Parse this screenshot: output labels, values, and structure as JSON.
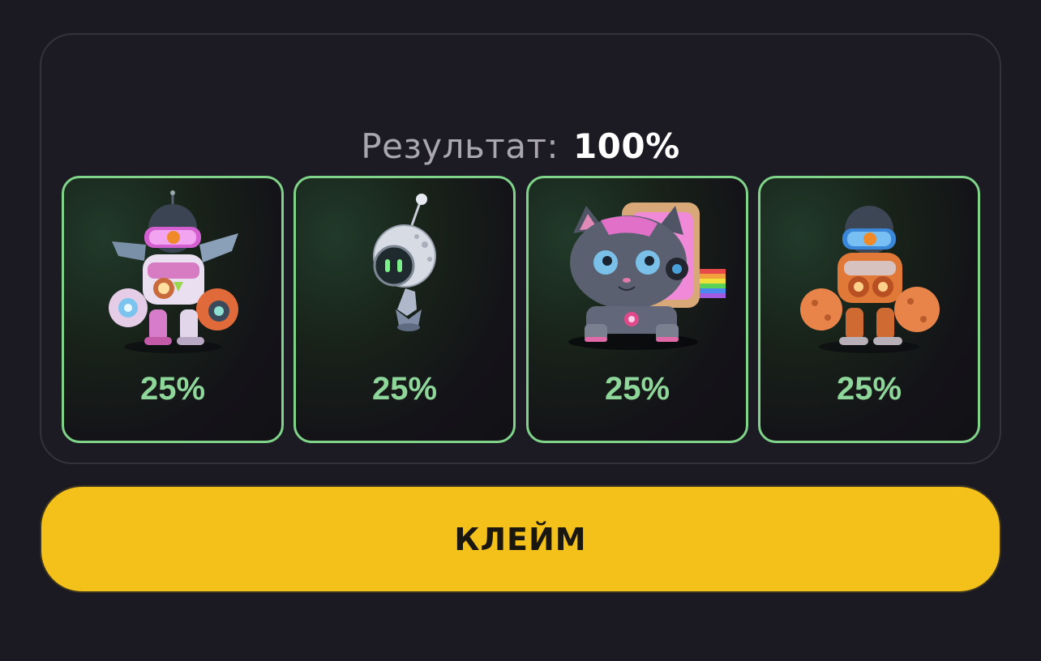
{
  "result": {
    "label": "Результат:",
    "value": "100%"
  },
  "cards": [
    {
      "name": "pink-mech-robot",
      "percent": "25%"
    },
    {
      "name": "small-floating-robot",
      "percent": "25%"
    },
    {
      "name": "robot-cat",
      "percent": "25%"
    },
    {
      "name": "orange-mech-robot",
      "percent": "25%"
    }
  ],
  "claim_button": {
    "label": "КЛЕЙМ"
  },
  "colors": {
    "accent_green": "#7fd48a",
    "button_yellow": "#f4c01a",
    "background": "#1b1a22"
  }
}
